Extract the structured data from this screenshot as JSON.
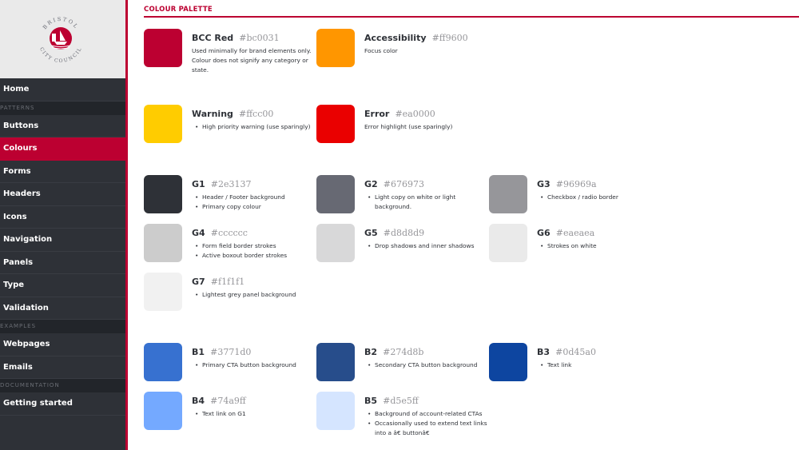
{
  "sidebar": {
    "logo_text_top": "BRISTOL",
    "logo_text_bottom": "CITY COUNCIL",
    "items": [
      {
        "type": "link",
        "label": "Home"
      },
      {
        "type": "section",
        "label": "PATTERNS"
      },
      {
        "type": "link",
        "label": "Buttons"
      },
      {
        "type": "link",
        "label": "Colours",
        "active": true
      },
      {
        "type": "link",
        "label": "Forms"
      },
      {
        "type": "link",
        "label": "Headers"
      },
      {
        "type": "link",
        "label": "Icons"
      },
      {
        "type": "link",
        "label": "Navigation"
      },
      {
        "type": "link",
        "label": "Panels"
      },
      {
        "type": "link",
        "label": "Type"
      },
      {
        "type": "link",
        "label": "Validation"
      },
      {
        "type": "section",
        "label": "EXAMPLES"
      },
      {
        "type": "link",
        "label": "Webpages"
      },
      {
        "type": "link",
        "label": "Emails"
      },
      {
        "type": "section",
        "label": "DOCUMENTATION"
      },
      {
        "type": "link",
        "label": "Getting started"
      }
    ]
  },
  "main": {
    "title": "COLOUR PALETTE",
    "accent_color": "#bc0031",
    "swatches": [
      {
        "name": "BCC Red",
        "hex": "#bc0031",
        "description": "Used minimally for brand elements only. Colour does not signify any category or state."
      },
      {
        "name": "Accessibility",
        "hex": "#ff9600",
        "description": "Focus color"
      },
      {
        "name": "Warning",
        "hex": "#ffcc00",
        "bullets": [
          "High priority warning (use sparingly)"
        ]
      },
      {
        "name": "Error",
        "hex": "#ea0000",
        "description": "Error highlight (use sparingly)"
      },
      {
        "name": "G1",
        "hex": "#2e3137",
        "bullets": [
          "Header / Footer background",
          "Primary copy colour"
        ]
      },
      {
        "name": "G2",
        "hex": "#676973",
        "bullets": [
          "Light copy on white or light background."
        ]
      },
      {
        "name": "G3",
        "hex": "#96969a",
        "bullets": [
          "Checkbox / radio border"
        ]
      },
      {
        "name": "G4",
        "hex": "#cccccc",
        "bullets": [
          "Form field border strokes",
          "Active boxout border strokes"
        ]
      },
      {
        "name": "G5",
        "hex": "#d8d8d9",
        "bullets": [
          "Drop shadows and inner shadows"
        ]
      },
      {
        "name": "G6",
        "hex": "#eaeaea",
        "bullets": [
          "Strokes on white"
        ]
      },
      {
        "name": "G7",
        "hex": "#f1f1f1",
        "bullets": [
          "Lightest grey panel background"
        ]
      },
      {
        "name": "B1",
        "hex": "#3771d0",
        "bullets": [
          "Primary CTA button background"
        ]
      },
      {
        "name": "B2",
        "hex": "#274d8b",
        "bullets": [
          "Secondary CTA button background"
        ]
      },
      {
        "name": "B3",
        "hex": "#0d45a0",
        "bullets": [
          "Text link"
        ]
      },
      {
        "name": "B4",
        "hex": "#74a9ff",
        "bullets": [
          "Text link on G1"
        ]
      },
      {
        "name": "B5",
        "hex": "#d5e5ff",
        "bullets": [
          "Background of account-related CTAs",
          "Occasionally used to extend text links into a â€ buttonâ€"
        ]
      }
    ]
  }
}
